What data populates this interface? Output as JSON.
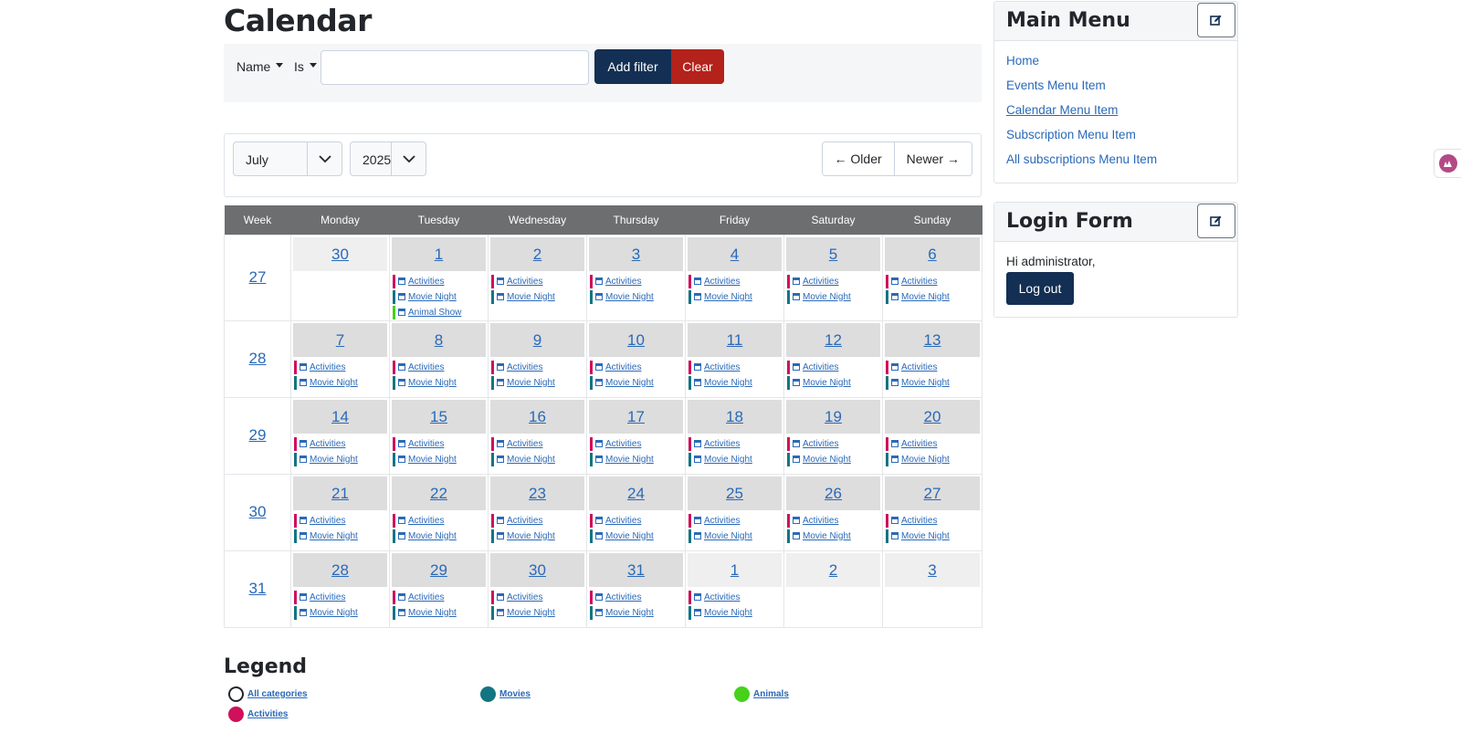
{
  "page": {
    "title": "Calendar"
  },
  "filter": {
    "field_label": "Name",
    "operator_label": "Is",
    "value": "",
    "add_label": "Add filter",
    "clear_label": "Clear"
  },
  "nav": {
    "month": "July",
    "year": "2025",
    "older_label": "← Older",
    "newer_label": "Newer →"
  },
  "colors": {
    "activities": "#d0105b",
    "movies": "#137582",
    "animals": "#47d11a",
    "primary_button": "#132f53",
    "clear_button": "#b3221b"
  },
  "calendar": {
    "headers": [
      "Week",
      "Monday",
      "Tuesday",
      "Wednesday",
      "Thursday",
      "Friday",
      "Saturday",
      "Sunday"
    ],
    "weeks": [
      {
        "week": "27",
        "days": [
          {
            "day": "30",
            "other": true,
            "events": []
          },
          {
            "day": "1",
            "other": false,
            "events": [
              {
                "label": "Activities",
                "category": "activities"
              },
              {
                "label": "Movie Night",
                "category": "movies"
              },
              {
                "label": "Animal Show",
                "category": "animals"
              }
            ]
          },
          {
            "day": "2",
            "other": false,
            "events": [
              {
                "label": "Activities",
                "category": "activities"
              },
              {
                "label": "Movie Night",
                "category": "movies"
              }
            ]
          },
          {
            "day": "3",
            "other": false,
            "events": [
              {
                "label": "Activities",
                "category": "activities"
              },
              {
                "label": "Movie Night",
                "category": "movies"
              }
            ]
          },
          {
            "day": "4",
            "other": false,
            "events": [
              {
                "label": "Activities",
                "category": "activities"
              },
              {
                "label": "Movie Night",
                "category": "movies"
              }
            ]
          },
          {
            "day": "5",
            "other": false,
            "events": [
              {
                "label": "Activities",
                "category": "activities"
              },
              {
                "label": "Movie Night",
                "category": "movies"
              }
            ]
          },
          {
            "day": "6",
            "other": false,
            "events": [
              {
                "label": "Activities",
                "category": "activities"
              },
              {
                "label": "Movie Night",
                "category": "movies"
              }
            ]
          }
        ]
      },
      {
        "week": "28",
        "days": [
          {
            "day": "7",
            "other": false,
            "events": [
              {
                "label": "Activities",
                "category": "activities"
              },
              {
                "label": "Movie Night",
                "category": "movies"
              }
            ]
          },
          {
            "day": "8",
            "other": false,
            "events": [
              {
                "label": "Activities",
                "category": "activities"
              },
              {
                "label": "Movie Night",
                "category": "movies"
              }
            ]
          },
          {
            "day": "9",
            "other": false,
            "events": [
              {
                "label": "Activities",
                "category": "activities"
              },
              {
                "label": "Movie Night",
                "category": "movies"
              }
            ]
          },
          {
            "day": "10",
            "other": false,
            "events": [
              {
                "label": "Activities",
                "category": "activities"
              },
              {
                "label": "Movie Night",
                "category": "movies"
              }
            ]
          },
          {
            "day": "11",
            "other": false,
            "events": [
              {
                "label": "Activities",
                "category": "activities"
              },
              {
                "label": "Movie Night",
                "category": "movies"
              }
            ]
          },
          {
            "day": "12",
            "other": false,
            "events": [
              {
                "label": "Activities",
                "category": "activities"
              },
              {
                "label": "Movie Night",
                "category": "movies"
              }
            ]
          },
          {
            "day": "13",
            "other": false,
            "events": [
              {
                "label": "Activities",
                "category": "activities"
              },
              {
                "label": "Movie Night",
                "category": "movies"
              }
            ]
          }
        ]
      },
      {
        "week": "29",
        "days": [
          {
            "day": "14",
            "other": false,
            "events": [
              {
                "label": "Activities",
                "category": "activities"
              },
              {
                "label": "Movie Night",
                "category": "movies"
              }
            ]
          },
          {
            "day": "15",
            "other": false,
            "events": [
              {
                "label": "Activities",
                "category": "activities"
              },
              {
                "label": "Movie Night",
                "category": "movies"
              }
            ]
          },
          {
            "day": "16",
            "other": false,
            "events": [
              {
                "label": "Activities",
                "category": "activities"
              },
              {
                "label": "Movie Night",
                "category": "movies"
              }
            ]
          },
          {
            "day": "17",
            "other": false,
            "events": [
              {
                "label": "Activities",
                "category": "activities"
              },
              {
                "label": "Movie Night",
                "category": "movies"
              }
            ]
          },
          {
            "day": "18",
            "other": false,
            "events": [
              {
                "label": "Activities",
                "category": "activities"
              },
              {
                "label": "Movie Night",
                "category": "movies"
              }
            ]
          },
          {
            "day": "19",
            "other": false,
            "events": [
              {
                "label": "Activities",
                "category": "activities"
              },
              {
                "label": "Movie Night",
                "category": "movies"
              }
            ]
          },
          {
            "day": "20",
            "other": false,
            "events": [
              {
                "label": "Activities",
                "category": "activities"
              },
              {
                "label": "Movie Night",
                "category": "movies"
              }
            ]
          }
        ]
      },
      {
        "week": "30",
        "days": [
          {
            "day": "21",
            "other": false,
            "events": [
              {
                "label": "Activities",
                "category": "activities"
              },
              {
                "label": "Movie Night",
                "category": "movies"
              }
            ]
          },
          {
            "day": "22",
            "other": false,
            "events": [
              {
                "label": "Activities",
                "category": "activities"
              },
              {
                "label": "Movie Night",
                "category": "movies"
              }
            ]
          },
          {
            "day": "23",
            "other": false,
            "events": [
              {
                "label": "Activities",
                "category": "activities"
              },
              {
                "label": "Movie Night",
                "category": "movies"
              }
            ]
          },
          {
            "day": "24",
            "other": false,
            "events": [
              {
                "label": "Activities",
                "category": "activities"
              },
              {
                "label": "Movie Night",
                "category": "movies"
              }
            ]
          },
          {
            "day": "25",
            "other": false,
            "events": [
              {
                "label": "Activities",
                "category": "activities"
              },
              {
                "label": "Movie Night",
                "category": "movies"
              }
            ]
          },
          {
            "day": "26",
            "other": false,
            "events": [
              {
                "label": "Activities",
                "category": "activities"
              },
              {
                "label": "Movie Night",
                "category": "movies"
              }
            ]
          },
          {
            "day": "27",
            "other": false,
            "events": [
              {
                "label": "Activities",
                "category": "activities"
              },
              {
                "label": "Movie Night",
                "category": "movies"
              }
            ]
          }
        ]
      },
      {
        "week": "31",
        "days": [
          {
            "day": "28",
            "other": false,
            "events": [
              {
                "label": "Activities",
                "category": "activities"
              },
              {
                "label": "Movie Night",
                "category": "movies"
              }
            ]
          },
          {
            "day": "29",
            "other": false,
            "events": [
              {
                "label": "Activities",
                "category": "activities"
              },
              {
                "label": "Movie Night",
                "category": "movies"
              }
            ]
          },
          {
            "day": "30",
            "other": false,
            "events": [
              {
                "label": "Activities",
                "category": "activities"
              },
              {
                "label": "Movie Night",
                "category": "movies"
              }
            ]
          },
          {
            "day": "31",
            "other": false,
            "events": [
              {
                "label": "Activities",
                "category": "activities"
              },
              {
                "label": "Movie Night",
                "category": "movies"
              }
            ]
          },
          {
            "day": "1",
            "other": true,
            "events": [
              {
                "label": "Activities",
                "category": "activities"
              },
              {
                "label": "Movie Night",
                "category": "movies"
              }
            ]
          },
          {
            "day": "2",
            "other": true,
            "events": []
          },
          {
            "day": "3",
            "other": true,
            "events": []
          }
        ]
      }
    ]
  },
  "legend": {
    "title": "Legend",
    "items": [
      {
        "label": "All categories",
        "category": "all"
      },
      {
        "label": "Movies",
        "category": "movies"
      },
      {
        "label": "Animals",
        "category": "animals"
      },
      {
        "label": "Activities",
        "category": "activities"
      }
    ]
  },
  "main_menu": {
    "title": "Main Menu",
    "edit_icon": "edit-icon",
    "items": [
      {
        "label": "Home",
        "current": false
      },
      {
        "label": "Events Menu Item",
        "current": false
      },
      {
        "label": "Calendar Menu Item",
        "current": true
      },
      {
        "label": "Subscription Menu Item",
        "current": false
      },
      {
        "label": "All subscriptions Menu Item",
        "current": false
      }
    ]
  },
  "login_form": {
    "title": "Login Form",
    "greeting": "Hi administrator,",
    "logout_label": "Log out"
  }
}
